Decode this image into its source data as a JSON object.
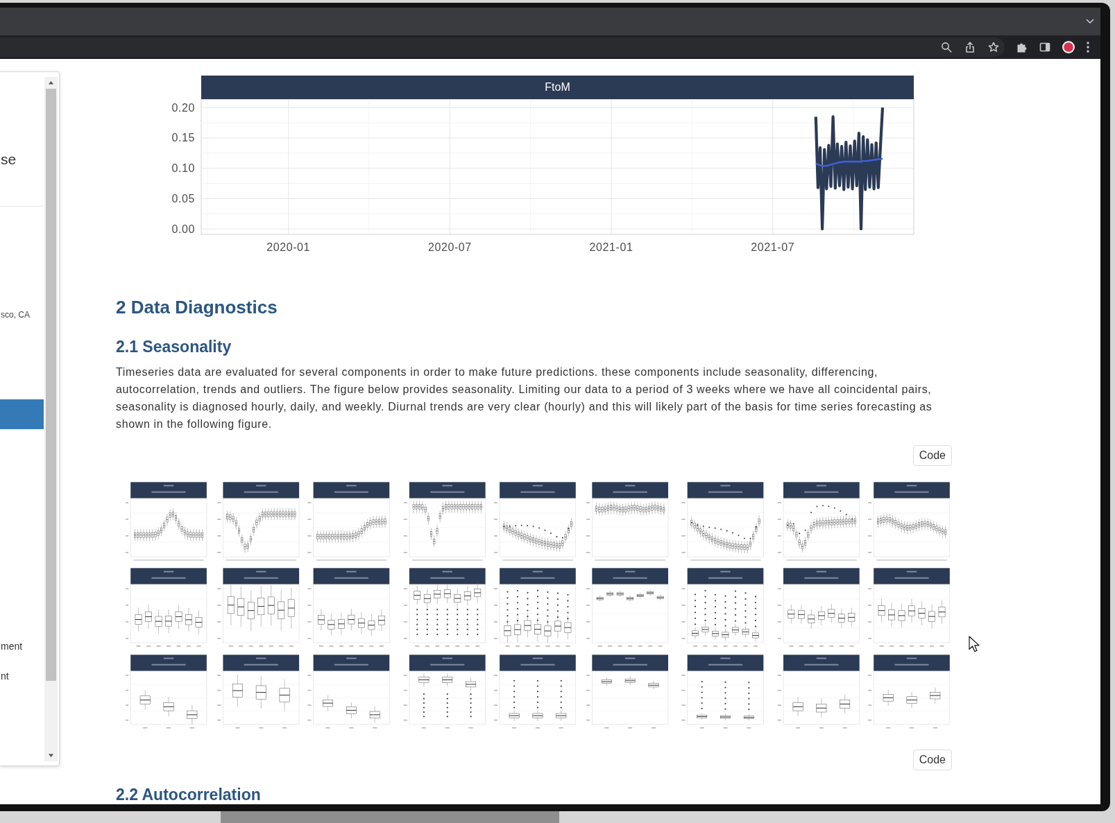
{
  "sidebar": {
    "header": [
      {
        "kind": "title",
        "text": "se"
      },
      {
        "kind": "byline",
        "text": "sco, CA"
      }
    ],
    "items": [
      {
        "selected": true
      },
      {
        "label": "ment",
        "selected": false
      },
      {
        "label": "nt",
        "selected": false
      }
    ]
  },
  "content": [
    {
      "kind": "chart",
      "chart_data": {
        "type": "line",
        "title": "FtoM",
        "grid": true,
        "categories": [
          null,
          null,
          null,
          null,
          null,
          null,
          null,
          null,
          null,
          null,
          null,
          null,
          null,
          null,
          null,
          null,
          null,
          null,
          null,
          null,
          null,
          null,
          null,
          null,
          null,
          null,
          null,
          null,
          null,
          null,
          null,
          null,
          null,
          null,
          null,
          null,
          null,
          null,
          null,
          null,
          "2020-01",
          null,
          null,
          null,
          null,
          null,
          null,
          null,
          null,
          null,
          null,
          null,
          null,
          null,
          null,
          null,
          null,
          null,
          null,
          null,
          null,
          null,
          null,
          null,
          null,
          null,
          null,
          null,
          null,
          null,
          null,
          null,
          null,
          null,
          null,
          null,
          null,
          null,
          null,
          null,
          null,
          null,
          null,
          null,
          null,
          null,
          null,
          null,
          null,
          null,
          null,
          null,
          null,
          null,
          null,
          null,
          null,
          null,
          null,
          null,
          null,
          null,
          null,
          null,
          null,
          null,
          null,
          null,
          null,
          null,
          null,
          null,
          null,
          null,
          null,
          "2020-07",
          null,
          null,
          null,
          null,
          null,
          null,
          null,
          null,
          null,
          null,
          null,
          null,
          null,
          null,
          null,
          null,
          null,
          null,
          null,
          null,
          null,
          null,
          null,
          null,
          null,
          null,
          null,
          null,
          null,
          null,
          null,
          null,
          null,
          null,
          null,
          null,
          null,
          null,
          null,
          null,
          null,
          null,
          null,
          null,
          null,
          null,
          null,
          null,
          null,
          null,
          null,
          null,
          null,
          null,
          null,
          null,
          null,
          null,
          null,
          null,
          null,
          null,
          null,
          null,
          null,
          null,
          null,
          null,
          null,
          null,
          null,
          null,
          null,
          null,
          "2021-01",
          null,
          null,
          null,
          null,
          null,
          null,
          null,
          null,
          null,
          null,
          null,
          null,
          null,
          null,
          null,
          null,
          null,
          null,
          null,
          null,
          null,
          null,
          null,
          null,
          null,
          null,
          null,
          null,
          null,
          null,
          null,
          null,
          null,
          null,
          null,
          null,
          null,
          null,
          null,
          null,
          null,
          null,
          null,
          null,
          null,
          null,
          null,
          null,
          null,
          null,
          null,
          null,
          null,
          null,
          null,
          null,
          null,
          null,
          null,
          null,
          null,
          null,
          null,
          null,
          null,
          null,
          null,
          null,
          null,
          null,
          null,
          null,
          null,
          null,
          "2021-07",
          null,
          null,
          null,
          null,
          null,
          null,
          null,
          null,
          null,
          null,
          null,
          null,
          null,
          null,
          null,
          null,
          null,
          null,
          null,
          null,
          null,
          null,
          null,
          null,
          null,
          null,
          null,
          null,
          null,
          null,
          null,
          null,
          null,
          null,
          null,
          null,
          null,
          null,
          null,
          null,
          null,
          null,
          null,
          null,
          null,
          null,
          null,
          null,
          null,
          null,
          null,
          null,
          null,
          null,
          null,
          null,
          null,
          null,
          null,
          null,
          null,
          null,
          null,
          null,
          null
        ],
        "ylim": [
          -0.009,
          0.214
        ],
        "yticks": [
          {
            "value": 0,
            "label": "0.00"
          },
          {
            "value": 0.05,
            "label": "0.05"
          },
          {
            "value": 0.1,
            "label": "0.10"
          },
          {
            "value": 0.15,
            "label": "0.15"
          },
          {
            "value": 0.2,
            "label": "0.20"
          }
        ],
        "series": [
          {
            "color": "#2b3a55",
            "values": [
              null,
              null,
              null,
              null,
              null,
              null,
              null,
              null,
              null,
              null,
              null,
              null,
              null,
              null,
              null,
              null,
              null,
              null,
              null,
              null,
              null,
              null,
              null,
              null,
              null,
              null,
              null,
              null,
              null,
              null,
              null,
              null,
              null,
              null,
              null,
              null,
              null,
              null,
              null,
              null,
              null,
              null,
              null,
              null,
              null,
              null,
              null,
              null,
              null,
              null,
              null,
              null,
              null,
              null,
              null,
              null,
              null,
              null,
              null,
              null,
              null,
              null,
              null,
              null,
              null,
              null,
              null,
              null,
              null,
              null,
              null,
              null,
              null,
              null,
              null,
              null,
              null,
              null,
              null,
              null,
              null,
              null,
              null,
              null,
              null,
              null,
              null,
              null,
              null,
              null,
              null,
              null,
              null,
              null,
              null,
              null,
              null,
              null,
              null,
              null,
              null,
              null,
              null,
              null,
              null,
              null,
              null,
              null,
              null,
              null,
              null,
              null,
              null,
              null,
              null,
              null,
              null,
              null,
              null,
              null,
              null,
              null,
              null,
              null,
              null,
              null,
              null,
              null,
              null,
              null,
              null,
              null,
              null,
              null,
              null,
              null,
              null,
              null,
              null,
              null,
              null,
              null,
              null,
              null,
              null,
              null,
              null,
              null,
              null,
              null,
              null,
              null,
              null,
              null,
              null,
              null,
              null,
              null,
              null,
              null,
              null,
              null,
              null,
              null,
              null,
              null,
              null,
              null,
              null,
              null,
              null,
              null,
              null,
              null,
              null,
              null,
              null,
              null,
              null,
              null,
              null,
              null,
              null,
              null,
              null,
              null,
              null,
              null,
              null,
              null,
              null,
              null,
              null,
              null,
              null,
              null,
              null,
              null,
              null,
              null,
              null,
              null,
              null,
              null,
              null,
              null,
              null,
              null,
              null,
              null,
              null,
              null,
              null,
              null,
              null,
              null,
              null,
              null,
              null,
              null,
              null,
              null,
              null,
              null,
              null,
              null,
              null,
              null,
              null,
              null,
              null,
              null,
              null,
              null,
              null,
              null,
              null,
              null,
              null,
              null,
              null,
              null,
              null,
              null,
              null,
              null,
              null,
              null,
              null,
              null,
              null,
              null,
              null,
              null,
              null,
              null,
              null,
              null,
              null,
              null,
              null,
              null,
              null,
              null,
              null,
              null,
              null,
              null,
              null,
              null,
              null,
              null,
              null,
              null,
              null,
              null,
              null,
              null,
              null,
              null,
              null,
              null,
              null,
              null,
              null,
              0.185,
              0.068,
              0.134,
              0.0,
              0.131,
              0.066,
              0.138,
              0.07,
              0.185,
              0.067,
              0.14,
              0.071,
              0.136,
              0.065,
              0.143,
              0.069,
              0.137,
              0.066,
              0.145,
              0.071,
              0.158,
              0.0,
              0.152,
              0.065,
              0.147,
              0.069,
              0.139,
              0.066,
              0.142,
              0.068,
              0.135,
              0.2,
              null,
              null,
              null,
              null,
              null,
              null,
              null,
              null,
              null,
              null,
              null,
              null,
              null,
              null
            ]
          },
          {
            "color": "#3d5fd6",
            "values": [
              null,
              null,
              null,
              null,
              null,
              null,
              null,
              null,
              null,
              null,
              null,
              null,
              null,
              null,
              null,
              null,
              null,
              null,
              null,
              null,
              null,
              null,
              null,
              null,
              null,
              null,
              null,
              null,
              null,
              null,
              null,
              null,
              null,
              null,
              null,
              null,
              null,
              null,
              null,
              null,
              null,
              null,
              null,
              null,
              null,
              null,
              null,
              null,
              null,
              null,
              null,
              null,
              null,
              null,
              null,
              null,
              null,
              null,
              null,
              null,
              null,
              null,
              null,
              null,
              null,
              null,
              null,
              null,
              null,
              null,
              null,
              null,
              null,
              null,
              null,
              null,
              null,
              null,
              null,
              null,
              null,
              null,
              null,
              null,
              null,
              null,
              null,
              null,
              null,
              null,
              null,
              null,
              null,
              null,
              null,
              null,
              null,
              null,
              null,
              null,
              null,
              null,
              null,
              null,
              null,
              null,
              null,
              null,
              null,
              null,
              null,
              null,
              null,
              null,
              null,
              null,
              null,
              null,
              null,
              null,
              null,
              null,
              null,
              null,
              null,
              null,
              null,
              null,
              null,
              null,
              null,
              null,
              null,
              null,
              null,
              null,
              null,
              null,
              null,
              null,
              null,
              null,
              null,
              null,
              null,
              null,
              null,
              null,
              null,
              null,
              null,
              null,
              null,
              null,
              null,
              null,
              null,
              null,
              null,
              null,
              null,
              null,
              null,
              null,
              null,
              null,
              null,
              null,
              null,
              null,
              null,
              null,
              null,
              null,
              null,
              null,
              null,
              null,
              null,
              null,
              null,
              null,
              null,
              null,
              null,
              null,
              null,
              null,
              null,
              null,
              null,
              null,
              null,
              null,
              null,
              null,
              null,
              null,
              null,
              null,
              null,
              null,
              null,
              null,
              null,
              null,
              null,
              null,
              null,
              null,
              null,
              null,
              null,
              null,
              null,
              null,
              null,
              null,
              null,
              null,
              null,
              null,
              null,
              null,
              null,
              null,
              null,
              null,
              null,
              null,
              null,
              null,
              null,
              null,
              null,
              null,
              null,
              null,
              null,
              null,
              null,
              null,
              null,
              null,
              null,
              null,
              null,
              null,
              null,
              null,
              null,
              null,
              null,
              null,
              null,
              null,
              null,
              null,
              null,
              null,
              null,
              null,
              null,
              null,
              null,
              null,
              null,
              null,
              null,
              null,
              null,
              null,
              null,
              null,
              null,
              null,
              null,
              null,
              null,
              null,
              null,
              null,
              null,
              null,
              null,
              0.108,
              0.106,
              0.105,
              0.104,
              0.104,
              0.104,
              0.105,
              0.106,
              0.107,
              0.108,
              0.109,
              0.11,
              0.11,
              0.111,
              0.111,
              0.111,
              0.111,
              0.111,
              0.111,
              0.111,
              0.111,
              0.111,
              0.112,
              0.112,
              0.112,
              0.113,
              0.113,
              0.114,
              0.114,
              0.115,
              0.115,
              0.116,
              null,
              null,
              null,
              null,
              null,
              null,
              null,
              null,
              null,
              null,
              null,
              null,
              null,
              null
            ]
          }
        ]
      }
    },
    {
      "kind": "section_heading",
      "text": "2 Data Diagnostics"
    },
    {
      "kind": "subsection_heading",
      "text": "2.1 Seasonality"
    },
    {
      "kind": "paragraph",
      "text": "Timeseries data are evaluated for several components in order to make future predictions. these components include seasonality, differencing, autocorrelation, trends and outliers. The figure below provides seasonality. Limiting our data to a period of 3 weeks where we have all coincidental pairs, seasonality is diagnosed hourly, daily, and weekly. Diurnal trends are very clear (hourly) and this will likely part of the basis for time series forecasting as shown in the following figure."
    },
    {
      "kind": "code_button",
      "label": "Code"
    },
    {
      "kind": "boxplot_grid"
    },
    {
      "kind": "code_button",
      "label": "Code"
    },
    {
      "kind": "subsection_heading",
      "text": "2.2 Autocorrelation"
    }
  ]
}
